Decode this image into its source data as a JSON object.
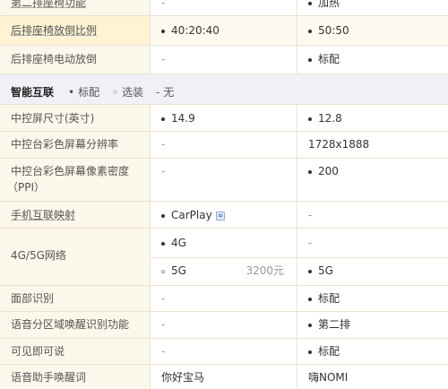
{
  "rows_top": [
    {
      "label": "第二排座椅功能",
      "v1": "-",
      "v2": "加热",
      "v1dash": true,
      "v2dot": true
    },
    {
      "label": "后排座椅放倒比例",
      "v1": "40:20:40",
      "v2": "50:50",
      "v1dot": true,
      "v2dot": true,
      "highlight": true
    },
    {
      "label": "后排座椅电动放倒",
      "v1": "-",
      "v2": "标配",
      "v1dash": true,
      "v2dot": true
    }
  ],
  "section": {
    "title": "智能互联",
    "legend": [
      {
        "glyph": "•",
        "text": "标配"
      },
      {
        "glyph": "◦",
        "text": "选装"
      },
      {
        "glyph": "-",
        "text": "无"
      }
    ]
  },
  "rows": [
    {
      "label": "中控屏尺寸(英寸)",
      "v1": "14.9",
      "v2": "12.8"
    },
    {
      "label": "中控台彩色屏幕分辨率",
      "v1": "-",
      "v2": "1728x1888"
    },
    {
      "label": "中控台彩色屏幕像素密度",
      "label2": "（PPI）",
      "v1": "-",
      "v2": "200"
    },
    {
      "label": "手机互联映射",
      "v1": "CarPlay",
      "v2": "-"
    },
    {
      "label": "4G/5G网络",
      "v1a": "4G",
      "v2a": "-",
      "v1b": "5G",
      "v1b_price": "3200元",
      "v2b": "5G"
    },
    {
      "label": "面部识别",
      "v1": "-",
      "v2": "标配"
    },
    {
      "label": "语音分区域唤醒识别功能",
      "v1": "-",
      "v2": "第二排"
    },
    {
      "label": "可见即可说",
      "v1": "-",
      "v2": "标配"
    },
    {
      "label": "语音助手唤醒词",
      "v1": "你好宝马",
      "v2": "嗨NOMI"
    }
  ]
}
